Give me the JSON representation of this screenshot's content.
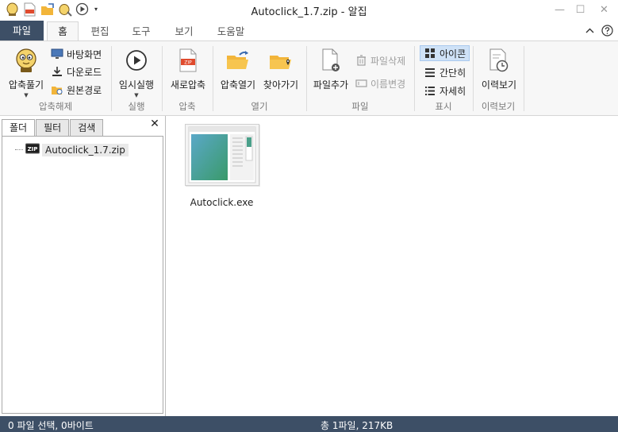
{
  "window": {
    "title": "Autoclick_1.7.zip - 알집",
    "minimize_label": "—",
    "maximize_label": "☐",
    "close_label": "✕"
  },
  "qat": {
    "icons": [
      "app-logo-icon",
      "zip-file-icon",
      "open-folder-icon",
      "settings-tool-icon",
      "play-icon"
    ],
    "dropdown_label": "▾"
  },
  "tabs": [
    {
      "label": "파일"
    },
    {
      "label": "홈"
    },
    {
      "label": "편집"
    },
    {
      "label": "도구"
    },
    {
      "label": "보기"
    },
    {
      "label": "도움말"
    }
  ],
  "ribbon": {
    "extract": {
      "main_label": "압축풀기",
      "desktop_label": "바탕화면",
      "download_label": "다운로드",
      "original_path_label": "원본경로",
      "group_label": "압축해제"
    },
    "run": {
      "temp_run_label": "임시실행",
      "group_label": "실행"
    },
    "compress": {
      "new_compress_label": "새로압축",
      "group_label": "압축"
    },
    "open": {
      "open_archive_label": "압축열기",
      "find_label": "찾아가기",
      "group_label": "열기"
    },
    "file": {
      "add_file_label": "파일추가",
      "delete_file_label": "파일삭제",
      "rename_label": "이름변경",
      "group_label": "파일"
    },
    "view": {
      "icon_label": "아이콘",
      "simple_label": "간단히",
      "detail_label": "자세히",
      "group_label": "표시"
    },
    "history": {
      "history_label": "이력보기",
      "group_label": "이력보기"
    }
  },
  "left_panel": {
    "tabs": [
      "폴더",
      "필터",
      "검색"
    ],
    "close_label": "✕",
    "tree_root": "Autoclick_1.7.zip"
  },
  "files": [
    {
      "name": "Autoclick.exe",
      "icon": "exe-file-thumbnail"
    }
  ],
  "status": {
    "left": "0 파일 선택,  0바이트",
    "right": "총 1파일,  217KB"
  },
  "colors": {
    "accent_dark": "#3d4f66",
    "selected_bg": "#cfe2f7",
    "ribbon_bg": "#f7f7f7"
  }
}
